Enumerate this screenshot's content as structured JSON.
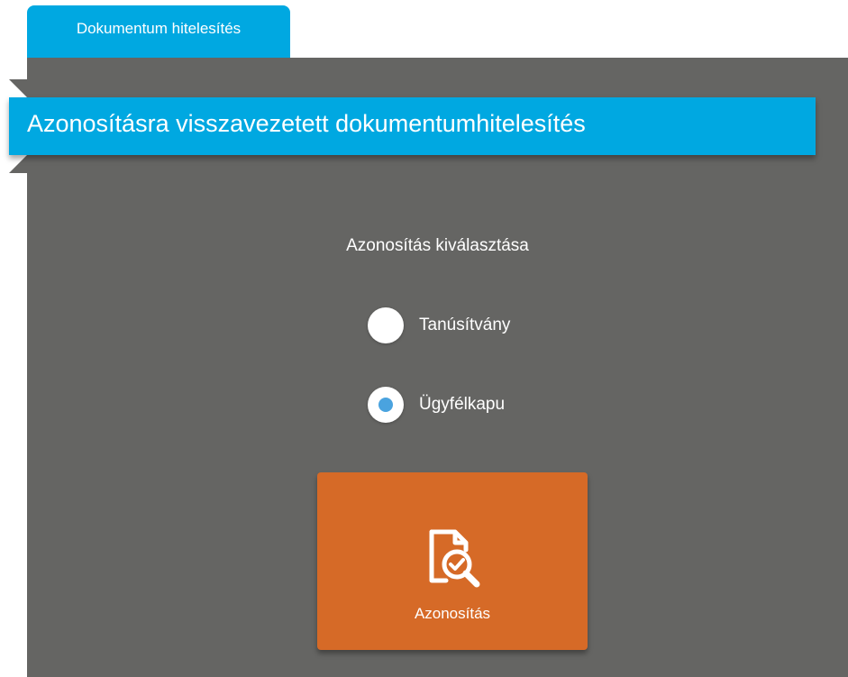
{
  "tabs": [
    {
      "label": "Dokumentum hitelesítés",
      "active": true
    }
  ],
  "banner": {
    "title": "Azonosításra visszavezetett dokumentumhitelesítés"
  },
  "identification": {
    "heading": "Azonosítás kiválasztása",
    "options": [
      {
        "label": "Tanúsítvány",
        "selected": false
      },
      {
        "label": "Ügyfélkapu",
        "selected": true
      }
    ]
  },
  "action": {
    "label": "Azonosítás",
    "icon": "document-search-check-icon"
  },
  "colors": {
    "accent": "#00a8e1",
    "panel": "#656563",
    "action": "#d66a27",
    "radio_selected": "#4aa3df"
  }
}
